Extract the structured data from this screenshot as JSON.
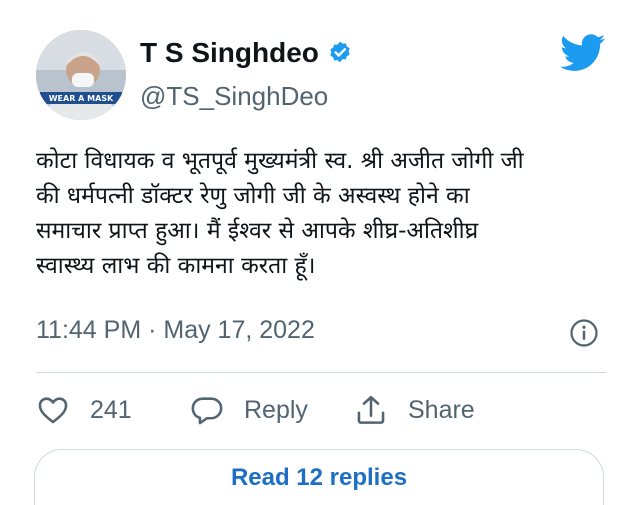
{
  "author": {
    "display_name": "T S Singhdeo",
    "handle": "@TS_SinghDeo",
    "verified": true,
    "avatar_badge_text": "WEAR A MASK"
  },
  "tweet": {
    "text_lines": [
      "कोटा विधायक व भूतपूर्व मुख्यमंत्री स्व. श्री अजीत जोगी जी",
      "की धर्मपत्नी डॉक्टर रेणु जोगी जी के अस्वस्थ होने का",
      "समाचार प्राप्त हुआ। मैं ईश्वर से आपके शीघ्र-अतिशीघ्र",
      "स्वास्थ्य लाभ की कामना करता हूँ।"
    ],
    "timestamp": "11:44 PM · May 17, 2022"
  },
  "actions": {
    "like_count": "241",
    "reply_label": "Reply",
    "share_label": "Share"
  },
  "read_replies_label": "Read 12 replies",
  "icons": [
    "twitter-bird-icon",
    "verified-badge-icon",
    "info-icon",
    "heart-icon",
    "reply-bubble-icon",
    "share-icon"
  ],
  "colors": {
    "twitter_blue": "#1d9bf0",
    "link_blue": "#1d6fc4",
    "muted_text": "#536471",
    "border": "#cfd9de"
  }
}
